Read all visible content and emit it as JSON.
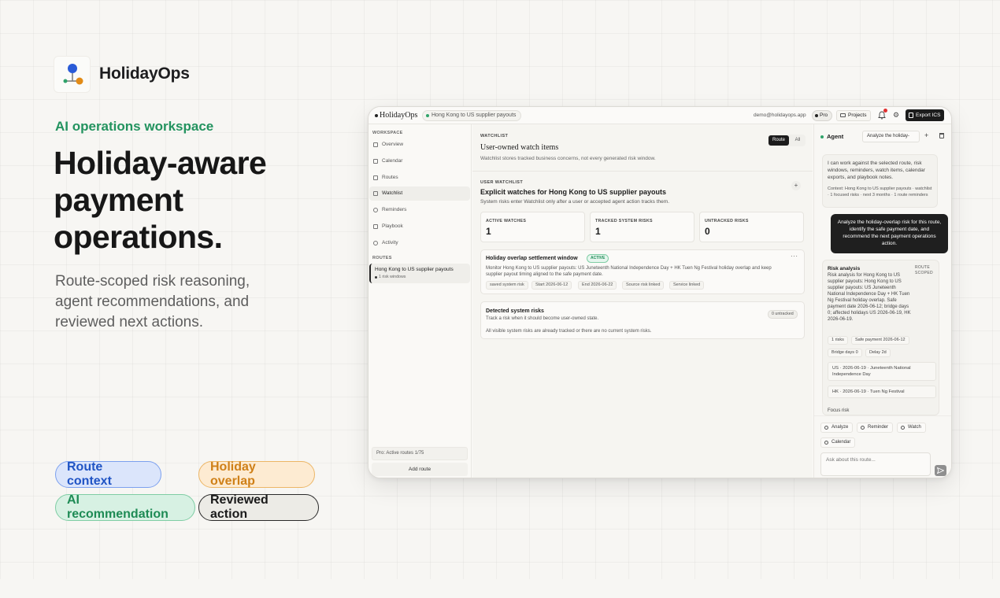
{
  "hero": {
    "brand": "HolidayOps",
    "eyebrow": "AI operations workspace",
    "headline": "Holiday-aware payment operations.",
    "subhead": "Route-scoped risk reasoning, agent recommendations, and reviewed next actions.",
    "pills": [
      "Route context",
      "Holiday overlap",
      "AI recommendation",
      "Reviewed action"
    ],
    "colors": {
      "accent_green": "#23935f",
      "blue": "#2054c4",
      "orange": "#cf8018"
    }
  },
  "topbar": {
    "app_title": "HolidayOps",
    "route_chip": "Hong Kong to US supplier payouts",
    "email": "demo@holidayops.app",
    "plan": "Pro",
    "projects": "Projects",
    "export": "Export ICS",
    "icons": [
      "bell-icon",
      "gear-icon",
      "folder-icon",
      "calendar-export-icon"
    ]
  },
  "sidebar": {
    "workspace_label": "WORKSPACE",
    "items": [
      "Overview",
      "Calendar",
      "Routes",
      "Watchlist",
      "Reminders",
      "Playbook",
      "Activity"
    ],
    "active_item": "Watchlist",
    "routes_label": "ROUTES",
    "route": {
      "title": "Hong Kong to US supplier payouts",
      "sub": "1 risk windows"
    },
    "plan_status": "Pro: Active routes 1/75",
    "add_route": "Add route"
  },
  "main": {
    "eyebrow": "WATCHLIST",
    "title": "User-owned watch items",
    "desc": "Watchlist stores tracked business concerns, not every generated risk window.",
    "toggle": {
      "route": "Route",
      "all": "All"
    },
    "user_watchlist": {
      "eyebrow": "USER WATCHLIST",
      "title": "Explicit watches for Hong Kong to US supplier payouts",
      "desc": "System risks enter Watchlist only after a user or accepted agent action tracks them.",
      "add": "+"
    },
    "stats": [
      {
        "label": "ACTIVE WATCHES",
        "value": "1"
      },
      {
        "label": "TRACKED SYSTEM RISKS",
        "value": "1"
      },
      {
        "label": "UNTRACKED RISKS",
        "value": "0"
      }
    ],
    "watch_card": {
      "title": "Holiday overlap settlement window",
      "badge": "ACTIVE",
      "more": "···",
      "desc": "Monitor Hong Kong to US supplier payouts: US Juneteenth National Independence Day + HK Tuen Ng Festival holiday overlap and keep supplier payout timing aligned to the safe payment date.",
      "tags": [
        "saved system risk",
        "Start 2026-06-12",
        "End 2026-06-22",
        "Source risk linked",
        "Service linked"
      ]
    },
    "detected_card": {
      "title": "Detected system risks",
      "badge": "0 untracked",
      "desc": "Track a risk when it should become user-owned state.",
      "desc2": "All visible system risks are already tracked or there are no current system risks."
    }
  },
  "agent": {
    "title": "Agent",
    "select": "Analyze the holiday-",
    "intro": "I can work against the selected route, risk windows, reminders, watch items, calendar exports, and playbook notes.",
    "context": "Context: Hong Kong to US supplier payouts · watchlist · 1 focused risks · next 3 months · 1 route reminders",
    "user_msg": "Analyze the holiday-overlap risk for this route, identify the safe payment date, and recommend the next payment operations action.",
    "analysis": {
      "title": "Risk analysis",
      "scope": "ROUTE SCOPED",
      "body": "Risk analysis for Hong Kong to US supplier payouts: Hong Kong to US supplier payouts: US Juneteenth National Independence Day + HK Tuen Ng Festival holiday overlap. Safe payment date 2026-06-12; bridge days 0; affected holidays US 2026-06-19, HK 2026-06-19.",
      "chips": [
        "1 risks",
        "Safe payment 2026-06-12",
        "Bridge days 0",
        "Delay 2d"
      ],
      "holidays": [
        "US · 2026-06-19 · Juneteenth National Independence Day",
        "HK · 2026-06-19 · Tuen Ng Festival"
      ],
      "focus": "Focus risk"
    },
    "actions": [
      "Analyze",
      "Reminder",
      "Watch",
      "Calendar"
    ],
    "input_placeholder": "Ask about this route..."
  }
}
